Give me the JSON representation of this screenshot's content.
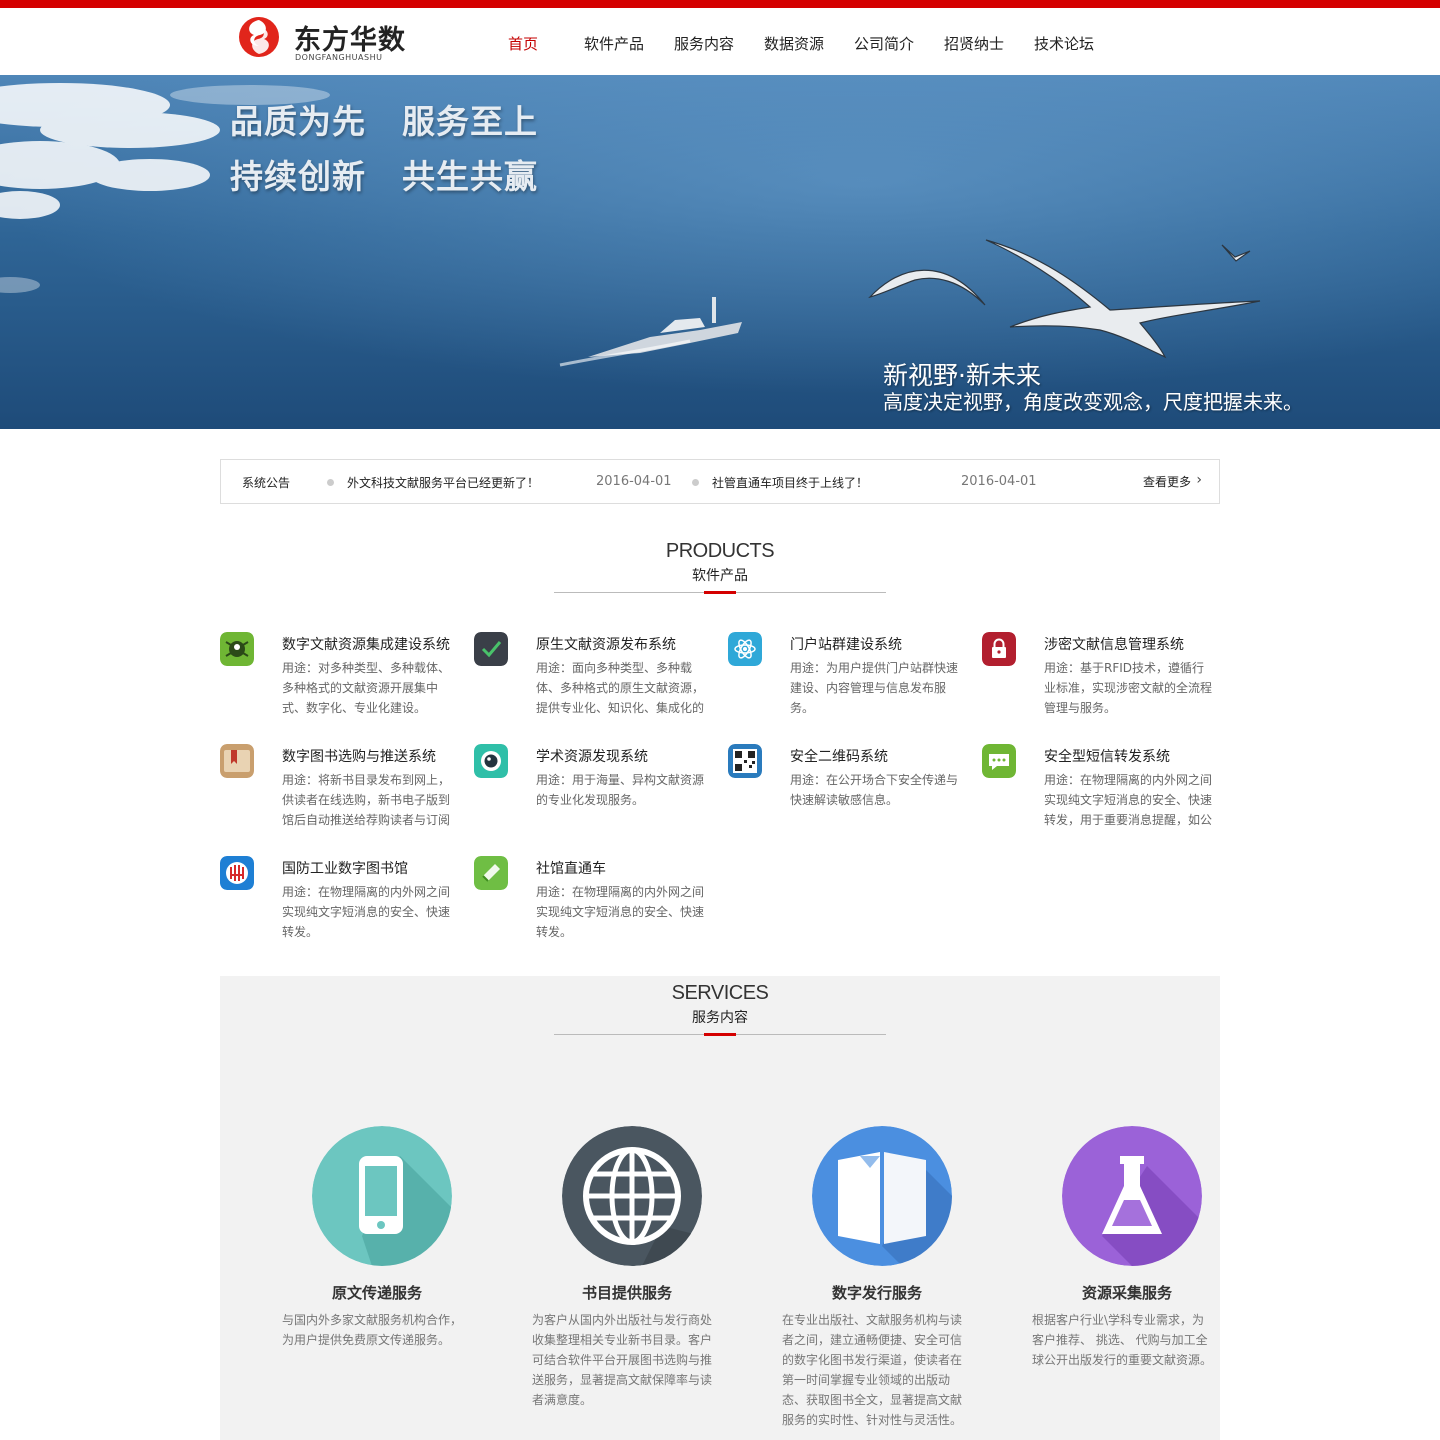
{
  "brand": {
    "name_zh": "东方华数",
    "name_en": "DONGFANGHUASHU",
    "accent": "#d40000"
  },
  "nav": {
    "items": [
      "首页",
      "软件产品",
      "服务内容",
      "数据资源",
      "公司简介",
      "招贤纳士",
      "技术论坛"
    ],
    "active": "首页"
  },
  "banner": {
    "slogans": [
      "品质为先",
      "服务至上",
      "持续创新",
      "共生共赢"
    ],
    "tagline": "新视野·新未来",
    "subline": "高度决定视野，角度改变观念，尺度把握未来。"
  },
  "notice": {
    "label": "系统公告",
    "items": [
      {
        "text": "外文科技文献服务平台已经更新了！",
        "date": "2016-04-01"
      },
      {
        "text": "社管直通车项目终于上线了！",
        "date": "2016-04-01"
      }
    ],
    "more": "查看更多"
  },
  "products": {
    "title_en": "PRODUCTS",
    "title_zh": "软件产品",
    "items": [
      {
        "title": "数字文献资源集成建设系统",
        "desc": "用途：对多种类型、多种载体、多种格式的文献资源开展集中式、数字化、专业化建设。",
        "icon": "bug-icon",
        "color": "#6fb634"
      },
      {
        "title": "原生文献资源发布系统",
        "desc": "用途：面向多种类型、多种载体、多种格式的原生文献资源，提供专业化、知识化、集成化的",
        "icon": "leaf-check-icon",
        "color": "#3a3f48"
      },
      {
        "title": "门户站群建设系统",
        "desc": "用途：为用户提供门户站群快速建设、内容管理与信息发布服务。",
        "icon": "atom-icon",
        "color": "#2fa8d8"
      },
      {
        "title": "涉密文献信息管理系统",
        "desc": "用途：基于RFID技术，遵循行业标准，实现涉密文献的全流程管理与服务。",
        "icon": "lock-icon",
        "color": "#b21f2f"
      },
      {
        "title": "数字图书选购与推送系统",
        "desc": "用途：将新书目录发布到网上，供读者在线选购，新书电子版到馆后自动推送给荐购读者与订阅",
        "icon": "book-bookmark-icon",
        "color": "#b58a5a"
      },
      {
        "title": "学术资源发现系统",
        "desc": "用途：用于海量、异构文献资源的专业化发现服务。",
        "icon": "camera-lens-icon",
        "color": "#2fbfa8"
      },
      {
        "title": "安全二维码系统",
        "desc": "用途：在公开场合下安全传递与快速解读敏感信息。",
        "icon": "qr-code-icon",
        "color": "#2a7bbd"
      },
      {
        "title": "安全型短信转发系统",
        "desc": "用途：在物理隔离的内外网之间实现纯文字短消息的安全、快速转发，用于重要消息提醒，如公",
        "icon": "chat-bubble-icon",
        "color": "#6fb634"
      },
      {
        "title": "国防工业数字图书馆",
        "desc": "用途：在物理隔离的内外网之间实现纯文字短消息的安全、快速转发。",
        "icon": "library-logo-icon",
        "color": "#1e7fd4"
      },
      {
        "title": "社馆直通车",
        "desc": "用途：在物理隔离的内外网之间实现纯文字短消息的安全、快速转发。",
        "icon": "transfer-icon",
        "color": "#6fbe44"
      }
    ]
  },
  "services": {
    "title_en": "SERVICES",
    "title_zh": "服务内容",
    "items": [
      {
        "title": "原文传递服务",
        "desc": "与国内外多家文献服务机构合作，为用户提供免费原文传递服务。",
        "icon": "mobile-phone-icon",
        "color": "#6cc6c0"
      },
      {
        "title": "书目提供服务",
        "desc": "为客户从国内外出版社与发行商处收集整理相关专业新书目录。客户可结合软件平台开展图书选购与推送服务，显著提高文献保障率与读者满意度。",
        "icon": "globe-icon",
        "color": "#4a5660"
      },
      {
        "title": "数字发行服务",
        "desc": "在专业出版社、文献服务机构与读者之间，建立通畅便捷、安全可信的数字化图书发行渠道，使读者在第一时间掌握专业领域的出版动态、获取图书全文，显著提高文献服务的实时性、针对性与灵活性。",
        "icon": "open-book-icon",
        "color": "#4b8fe0"
      },
      {
        "title": "资源采集服务",
        "desc": "根据客户行业\\学科专业需求，为客户推荐、 挑选、 代购与加工全球公开出版发行的重要文献资源。",
        "icon": "flask-icon",
        "color": "#9b62d8"
      }
    ]
  }
}
